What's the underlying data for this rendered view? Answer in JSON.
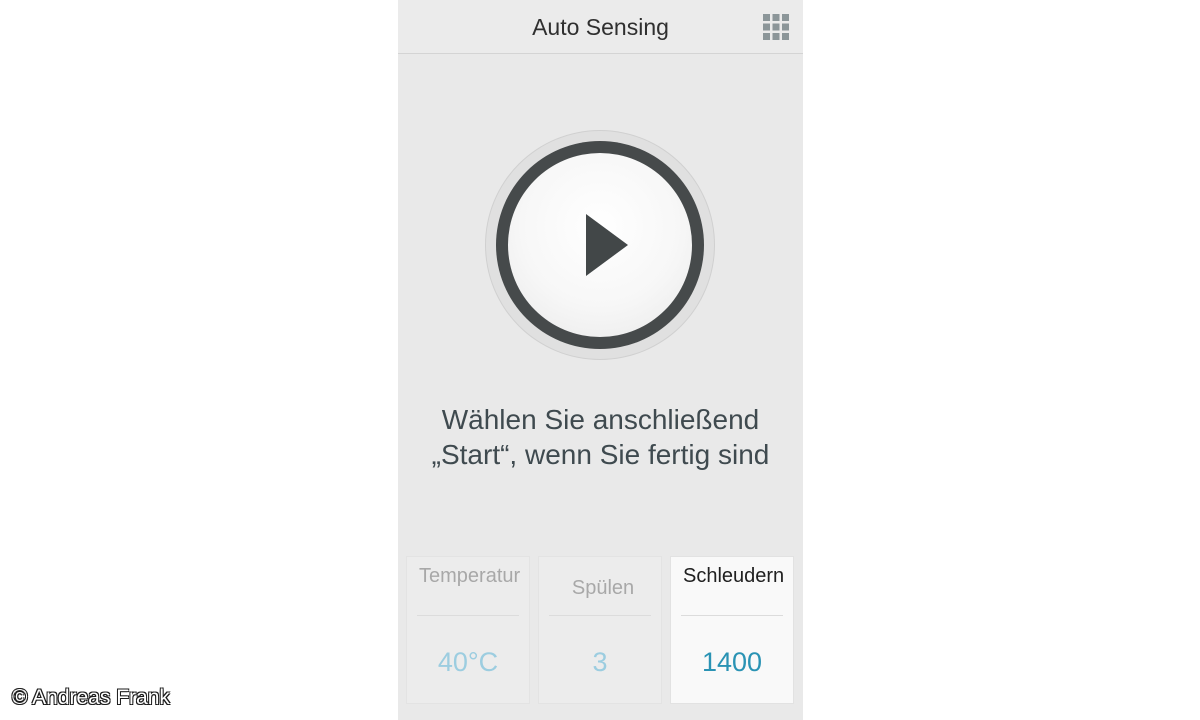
{
  "header": {
    "title": "Auto Sensing",
    "menu_icon": "grid-icon"
  },
  "play": {
    "icon": "play-icon",
    "ring_color": "#464a4b"
  },
  "instruction": {
    "line1": "Wählen Sie anschließend",
    "line2": "„Start“, wenn Sie fertig sind"
  },
  "options": [
    {
      "label": "Temperatur",
      "value": "40°C",
      "active": false
    },
    {
      "label": "Spülen",
      "value": "3",
      "active": false
    },
    {
      "label": "Schleudern",
      "value": "1400",
      "active": true
    }
  ],
  "watermark": "© Andreas Frank",
  "colors": {
    "accent": "#2a93b4",
    "inactive_value": "#9ccde0",
    "background": "#e9e9e9"
  }
}
